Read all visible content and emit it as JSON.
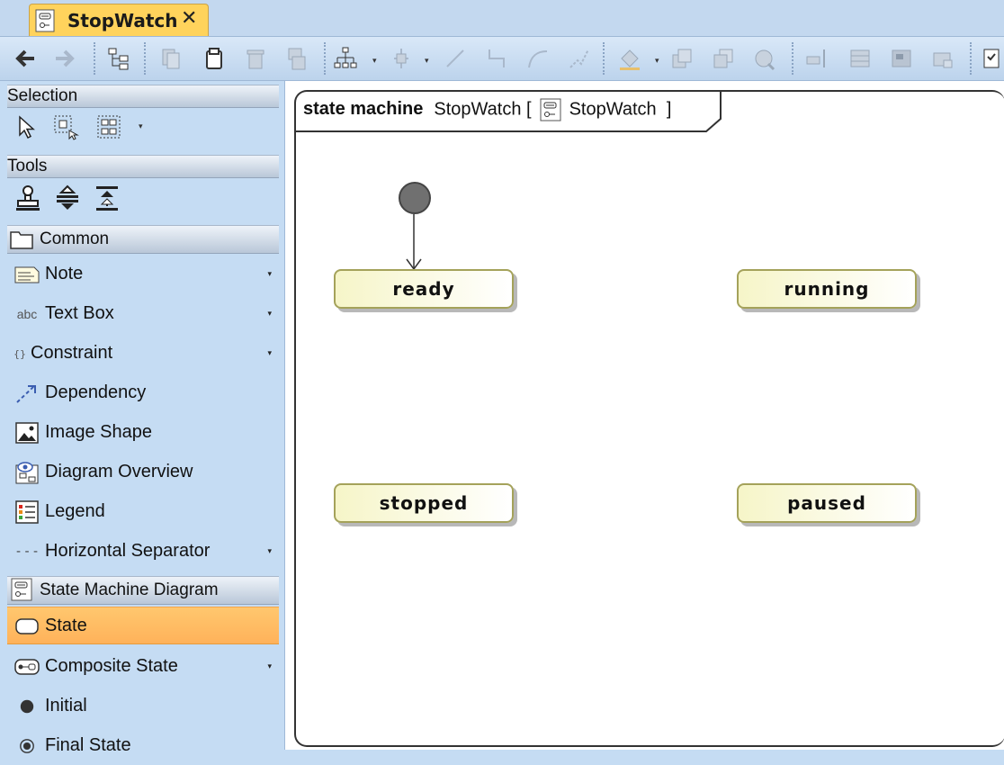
{
  "tab": {
    "title": "StopWatch"
  },
  "palette": {
    "selection_header": "Selection",
    "tools_header": "Tools",
    "common_header": "Common",
    "common_items": [
      {
        "label": "Note",
        "icon": "note-icon",
        "has_dropdown": true
      },
      {
        "label": "Text Box",
        "icon_text": "abc",
        "icon": "text-box-icon",
        "has_dropdown": true
      },
      {
        "label": "Constraint",
        "icon_text": "{}",
        "icon": "constraint-icon",
        "has_dropdown": true
      },
      {
        "label": "Dependency",
        "icon": "dependency-icon",
        "has_dropdown": false
      },
      {
        "label": "Image Shape",
        "icon": "image-icon",
        "has_dropdown": false
      },
      {
        "label": "Diagram Overview",
        "icon": "diagram-overview-icon",
        "has_dropdown": false
      },
      {
        "label": "Legend",
        "icon": "legend-icon",
        "has_dropdown": false
      },
      {
        "label": "Horizontal Separator",
        "icon_text": "- - -",
        "icon": "separator-icon",
        "has_dropdown": true
      }
    ],
    "smd_header": "State Machine Diagram",
    "smd_items": [
      {
        "label": "State",
        "icon": "state-icon",
        "selected": true,
        "has_dropdown": false
      },
      {
        "label": "Composite State",
        "icon": "composite-state-icon",
        "selected": false,
        "has_dropdown": true
      },
      {
        "label": "Initial",
        "icon": "initial-icon",
        "selected": false,
        "has_dropdown": false
      },
      {
        "label": "Final State",
        "icon": "final-state-icon",
        "selected": false,
        "has_dropdown": false
      }
    ],
    "accent_selected": "#ffb25a"
  },
  "diagram": {
    "frame_keyword": "state machine",
    "frame_name": "StopWatch [",
    "frame_ref": "StopWatch",
    "frame_close": "]",
    "states": [
      "ready",
      "running",
      "stopped",
      "paused"
    ]
  }
}
